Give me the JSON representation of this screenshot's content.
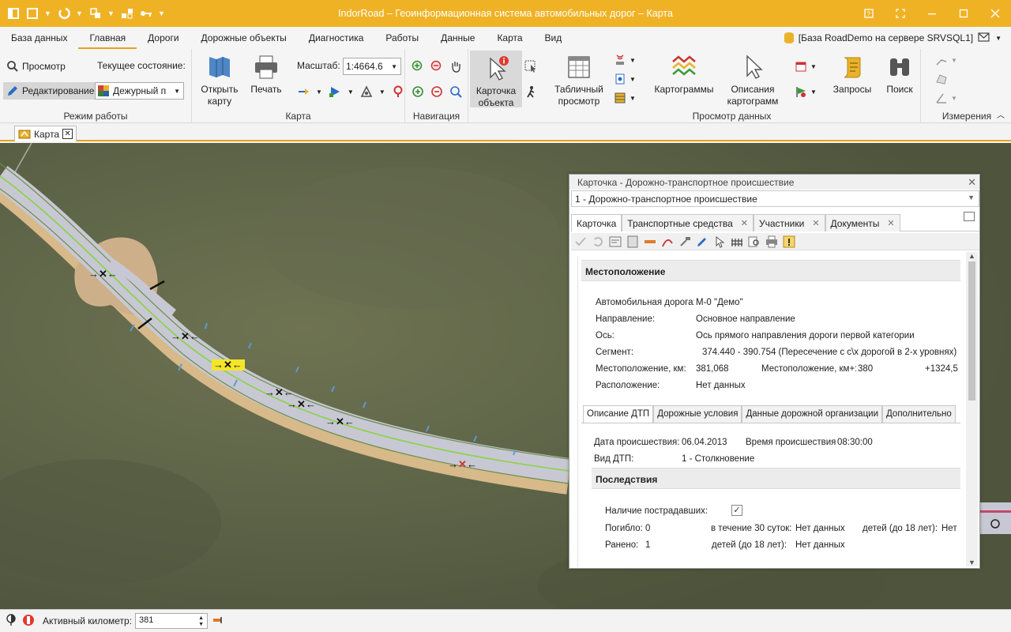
{
  "window": {
    "title": "IndorRoad – Геоинформационная система автомобильных дорог – Карта"
  },
  "menu": {
    "items": [
      "База данных",
      "Главная",
      "Дороги",
      "Дорожные объекты",
      "Диагностика",
      "Работы",
      "Данные",
      "Карта",
      "Вид"
    ],
    "active_index": 1,
    "database": "[База RoadDemo на сервере SRVSQL1]"
  },
  "ribbon": {
    "mode_group": {
      "label": "Режим работы",
      "view": "Просмотр",
      "edit": "Редактирование",
      "state_label": "Текущее состояние:",
      "state_value": "Дежурный п"
    },
    "map_group": {
      "label": "Карта",
      "open_map": "Открыть\nкарту",
      "print": "Печать",
      "scale_label": "Масштаб:",
      "scale_value": "1:4664.6"
    },
    "nav_group": {
      "label": "Навигация"
    },
    "object_card": "Карточка\nобъекта",
    "data_group": {
      "label": "Просмотр данных",
      "table_view": "Табличный\nпросмотр",
      "cartograms": "Картограммы",
      "cartogram_desc": "Описания\nкартограмм",
      "queries": "Запросы",
      "search": "Поиск"
    },
    "measure_group": {
      "label": "Измерения"
    }
  },
  "doc_tab": {
    "label": "Карта"
  },
  "card": {
    "title": "Карточка - Дорожно-транспортное происшествие",
    "selector": "1 - Дорожно-транспортное происшествие",
    "tabs": [
      "Карточка",
      "Транспортные средства",
      "Участники",
      "Документы"
    ],
    "location": {
      "header": "Местоположение",
      "road_label": "Автомобильная дорога:",
      "road_value": "М-0 \"Демо\"",
      "direction_label": "Направление:",
      "direction_value": "Основное направление",
      "axis_label": "Ось:",
      "axis_value": "Ось прямого направления дороги первой категории",
      "segment_label": "Сегмент:",
      "segment_value": "374.440 -    390.754 (Пересечение с с\\х дорогой в 2-х уровнях)",
      "km_label": "Местоположение, км:",
      "km_value": "381,068",
      "kmplus_label": "Местоположение, км+:",
      "kmplus_km": "380",
      "kmplus_m": "+1324,5",
      "placement_label": "Расположение:",
      "placement_value": "Нет данных"
    },
    "subtabs": [
      "Описание ДТП",
      "Дорожные условия",
      "Данные дорожной организации",
      "Дополнительно"
    ],
    "desc": {
      "date_label": "Дата происшествия:",
      "date_value": "06.04.2013",
      "time_label": "Время происшествия:",
      "time_value": "08:30:00",
      "type_label": "Вид ДТП:",
      "type_value": "1 - Столкновение",
      "consequences_header": "Последствия",
      "injured_label": "Наличие пострадавших:",
      "killed_label": "Погибло:",
      "killed_value": "0",
      "within30_label": "в течение 30 суток:",
      "within30_value": "Нет данных",
      "children_label": "детей (до 18 лет):",
      "children_killed_value": "Нет",
      "wounded_label": "Ранено:",
      "wounded_value": "1",
      "children_wounded_label": "детей (до 18 лет):",
      "children_wounded_value": "Нет данных"
    }
  },
  "status": {
    "active_km_label": "Активный километр:",
    "active_km_value": "381"
  },
  "colors": {
    "titlebar": "#f0b225",
    "accent": "#e8a317",
    "road": "#c8c8d4",
    "centerline": "#8fd14f",
    "shoulder": "#d7b98a"
  }
}
